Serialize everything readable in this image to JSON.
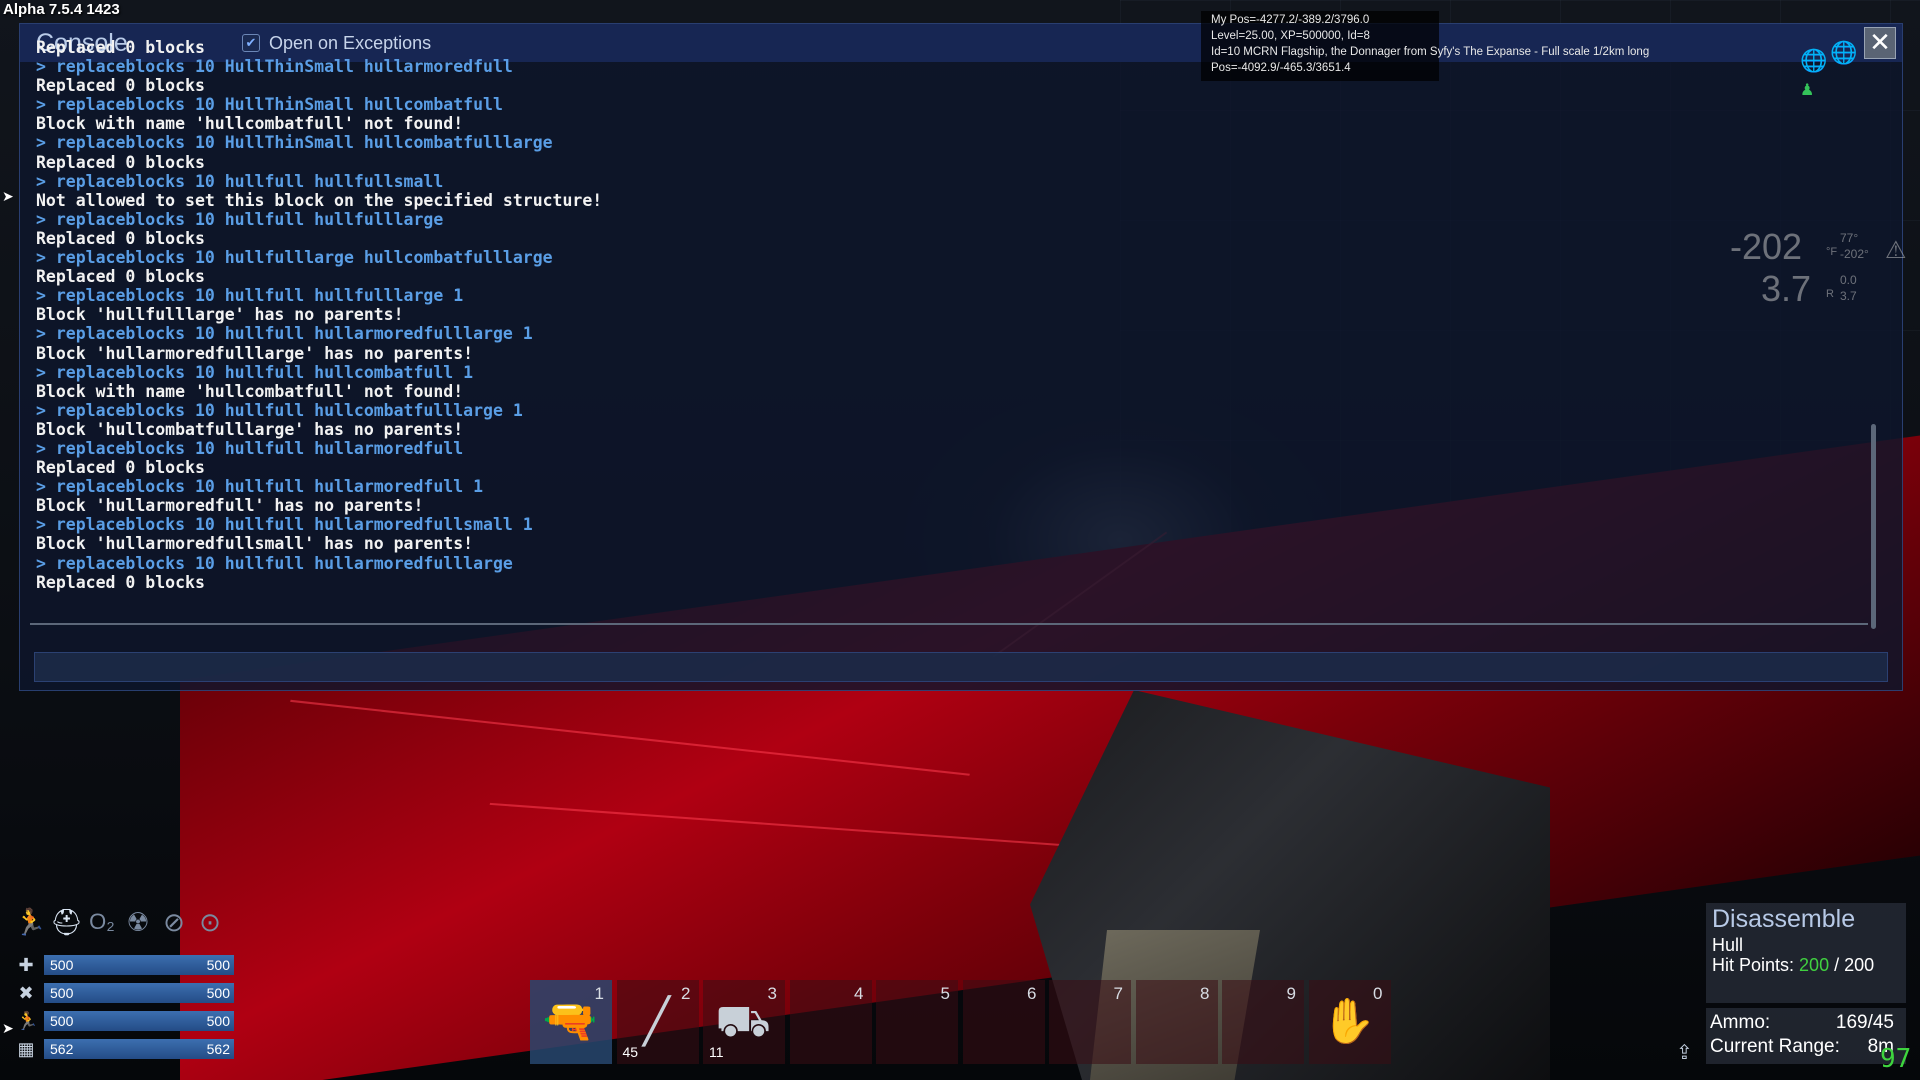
{
  "version": "Alpha 7.5.4 1423",
  "console": {
    "title": "Console",
    "exceptions_label": "Open on Exceptions",
    "exceptions_checked": true,
    "close_glyph": "✕",
    "lines": [
      {
        "type": "out",
        "text": "Replaced 0 blocks"
      },
      {
        "type": "cmd",
        "text": "> replaceblocks 10 HullThinSmall hullarmoredfull"
      },
      {
        "type": "out",
        "text": "Replaced 0 blocks"
      },
      {
        "type": "cmd",
        "text": "> replaceblocks 10 HullThinSmall hullcombatfull"
      },
      {
        "type": "out",
        "text": "Block with name 'hullcombatfull' not found!"
      },
      {
        "type": "cmd",
        "text": "> replaceblocks 10 HullThinSmall hullcombatfulllarge"
      },
      {
        "type": "out",
        "text": "Replaced 0 blocks"
      },
      {
        "type": "cmd",
        "text": "> replaceblocks 10 hullfull hullfullsmall"
      },
      {
        "type": "out",
        "text": "Not allowed to set this block on the specified structure!"
      },
      {
        "type": "cmd",
        "text": "> replaceblocks 10 hullfull hullfulllarge"
      },
      {
        "type": "out",
        "text": "Replaced 0 blocks"
      },
      {
        "type": "cmd",
        "text": "> replaceblocks 10 hullfulllarge hullcombatfulllarge"
      },
      {
        "type": "out",
        "text": "Replaced 0 blocks"
      },
      {
        "type": "cmd",
        "text": "> replaceblocks 10 hullfull hullfulllarge 1"
      },
      {
        "type": "out",
        "text": "Block 'hullfulllarge' has no parents!"
      },
      {
        "type": "cmd",
        "text": "> replaceblocks 10 hullfull hullarmoredfulllarge 1"
      },
      {
        "type": "out",
        "text": "Block 'hullarmoredfulllarge' has no parents!"
      },
      {
        "type": "cmd",
        "text": "> replaceblocks 10 hullfull hullcombatfull 1"
      },
      {
        "type": "out",
        "text": "Block with name 'hullcombatfull' not found!"
      },
      {
        "type": "cmd",
        "text": "> replaceblocks 10 hullfull hullcombatfulllarge 1"
      },
      {
        "type": "out",
        "text": "Block 'hullcombatfulllarge' has no parents!"
      },
      {
        "type": "cmd",
        "text": "> replaceblocks 10 hullfull hullarmoredfull"
      },
      {
        "type": "out",
        "text": "Replaced 0 blocks"
      },
      {
        "type": "cmd",
        "text": "> replaceblocks 10 hullfull hullarmoredfull 1"
      },
      {
        "type": "out",
        "text": "Block 'hullarmoredfull' has no parents!"
      },
      {
        "type": "cmd",
        "text": "> replaceblocks 10 hullfull hullarmoredfullsmall 1"
      },
      {
        "type": "out",
        "text": "Block 'hullarmoredfullsmall' has no parents!"
      },
      {
        "type": "cmd",
        "text": "> replaceblocks 10 hullfull hullarmoredfulllarge"
      },
      {
        "type": "out",
        "text": "Replaced 0 blocks"
      }
    ],
    "input_value": ""
  },
  "debug": {
    "pos": "My Pos=-4277.2/-389.2/3796.0",
    "level": "Level=25.00, XP=500000, Id=8",
    "target": "Id=10 MCRN Flagship, the Donnager from Syfy's The Expanse - Full scale 1/2km long",
    "target_pos": "Pos=-4092.9/-465.3/3651.4"
  },
  "environment": {
    "temperature": "-202",
    "temp_unit": "°F",
    "temp_side_1": "77°",
    "temp_side_2": "-202°",
    "radiation": "3.7",
    "rad_unit": "R",
    "rad_side_1": "0.0",
    "rad_side_2": "3.7"
  },
  "status_icons": [
    "stamina-icon",
    "helmet-icon",
    "oxygen-icon",
    "radiation-icon",
    "hunger-icon",
    "armor-icon"
  ],
  "oxygen_glyph": "O₂",
  "stats": [
    {
      "name": "health",
      "icon": "✚",
      "current": "500",
      "max": "500",
      "fraction": 1.0
    },
    {
      "name": "food",
      "icon": "✖",
      "current": "500",
      "max": "500",
      "fraction": 1.0
    },
    {
      "name": "stamina",
      "icon": "🏃",
      "current": "500",
      "max": "500",
      "fraction": 1.0
    },
    {
      "name": "oxygen",
      "icon": "▦",
      "current": "562",
      "max": "562",
      "fraction": 1.0
    }
  ],
  "hotbar": [
    {
      "num": "1",
      "count": "",
      "item": "multitool",
      "selected": true
    },
    {
      "num": "2",
      "count": "45",
      "item": "rifle-ammo",
      "selected": false
    },
    {
      "num": "3",
      "count": "11",
      "item": "turret",
      "selected": false
    },
    {
      "num": "4",
      "count": "",
      "item": "",
      "selected": false
    },
    {
      "num": "5",
      "count": "",
      "item": "",
      "selected": false
    },
    {
      "num": "6",
      "count": "",
      "item": "",
      "selected": false
    },
    {
      "num": "7",
      "count": "",
      "item": "",
      "selected": false
    },
    {
      "num": "8",
      "count": "",
      "item": "",
      "selected": false
    },
    {
      "num": "9",
      "count": "",
      "item": "",
      "selected": false
    },
    {
      "num": "0",
      "count": "",
      "item": "hand",
      "selected": false
    }
  ],
  "target_panel": {
    "mode": "Disassemble",
    "block": "Hull",
    "hp_label": "Hit Points:",
    "hp_current": "200",
    "hp_sep": " / ",
    "hp_max": "200"
  },
  "weapon": {
    "ammo_label": "Ammo:",
    "ammo_value": "169/45",
    "range_label": "Current Range:",
    "range_value": "8m"
  },
  "fps": "97",
  "colors": {
    "cmd": "#5a9ee6",
    "out": "#f2f2f2",
    "accent": "#3c6fb0",
    "hp_good": "#40d040"
  }
}
